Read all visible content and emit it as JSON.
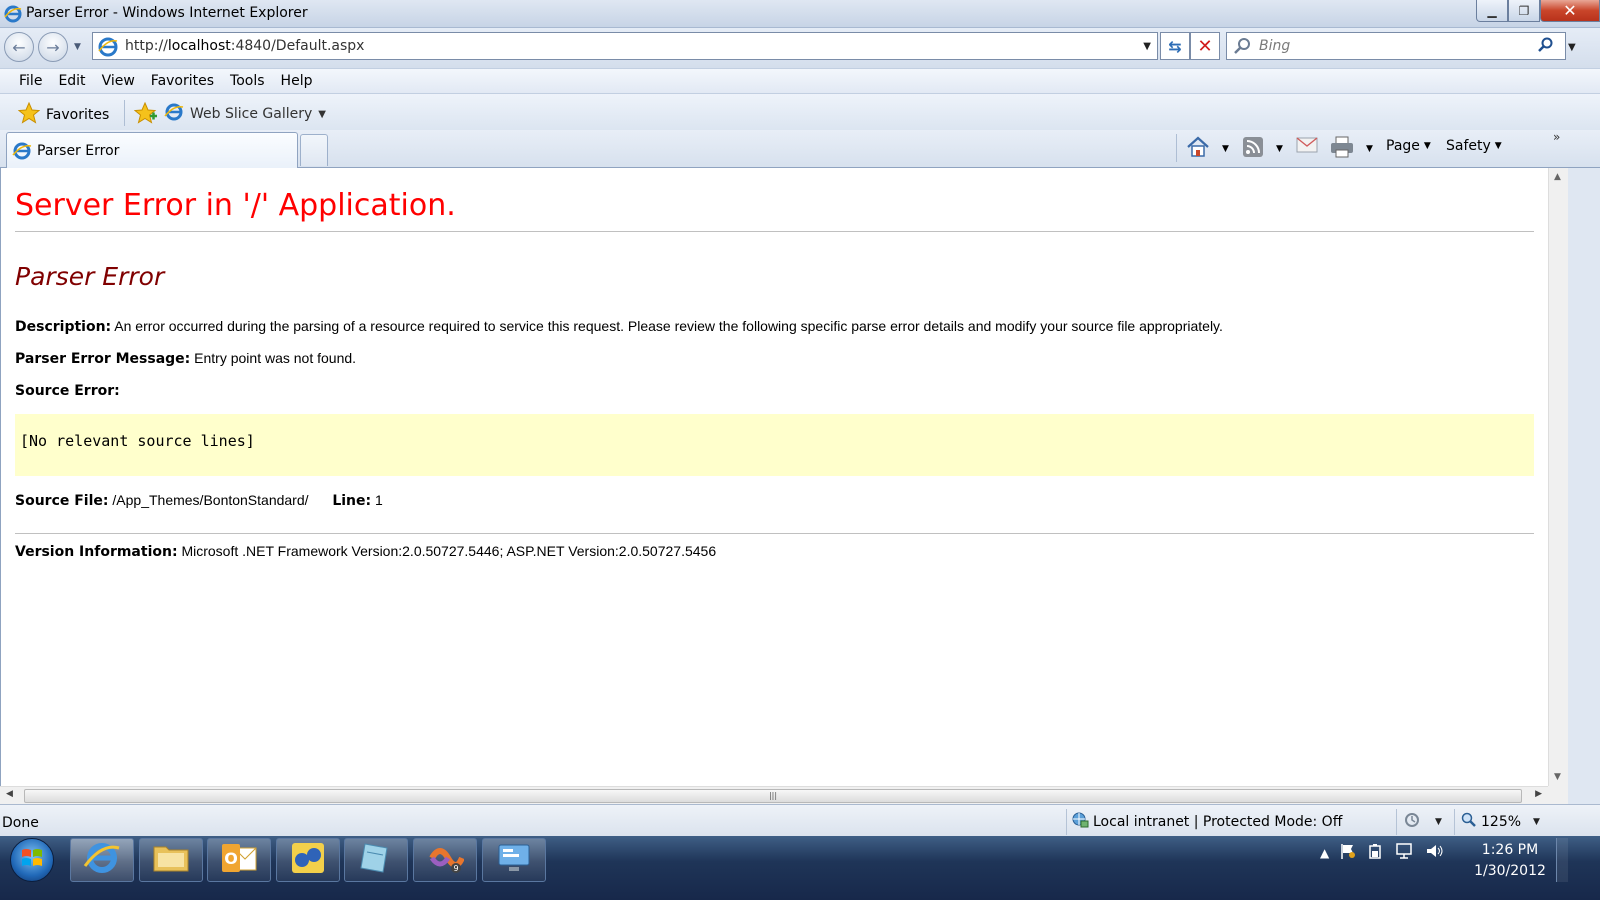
{
  "window": {
    "title": "Parser Error - Windows Internet Explorer"
  },
  "navbar": {
    "url_prefix": "http://",
    "url_host": "localhost",
    "url_rest": ":4840/Default.aspx",
    "search_placeholder": "Bing"
  },
  "menu": [
    "File",
    "Edit",
    "View",
    "Favorites",
    "Tools",
    "Help"
  ],
  "favorites_bar": {
    "favorites_label": "Favorites",
    "web_slice_label": "Web Slice Gallery"
  },
  "tab": {
    "label": "Parser Error"
  },
  "commands": {
    "page_label": "Page",
    "safety_label": "Safety"
  },
  "page": {
    "heading": "Server Error in '/' Application.",
    "subheading": "Parser Error",
    "description_label": "Description:",
    "description_text": "An error occurred during the parsing of a resource required to service this request. Please review the following specific parse error details and modify your source file appropriately.",
    "parser_msg_label": "Parser Error Message:",
    "parser_msg_text": "Entry point was not found.",
    "source_error_label": "Source Error:",
    "source_code": "[No relevant source lines]",
    "source_file_label": "Source File:",
    "source_file_text": "/App_Themes/BontonStandard/",
    "line_label": "Line:",
    "line_value": "1",
    "version_label": "Version Information:",
    "version_text": "Microsoft .NET Framework Version:2.0.50727.5446; ASP.NET Version:2.0.50727.5456"
  },
  "statusbar": {
    "status": "Done",
    "zone": "Local intranet | Protected Mode: Off",
    "zoom": "125%"
  },
  "taskbar": {
    "time": "1:26 PM",
    "date": "1/30/2012"
  },
  "colors": {
    "error_heading": "#ff0000",
    "parser_heading": "#800000",
    "code_background": "#ffffcc"
  }
}
